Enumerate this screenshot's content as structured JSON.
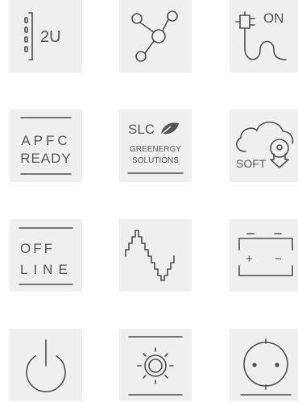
{
  "tiles": [
    {
      "id": "rack-2u",
      "text": "2U"
    },
    {
      "id": "network"
    },
    {
      "id": "plug-on",
      "text": "ON"
    },
    {
      "id": "apfc",
      "line1": "APFC",
      "line2": "READY"
    },
    {
      "id": "slc",
      "line1": "SLC",
      "line2": "GREENERGY",
      "line3": "SOLUTIONS"
    },
    {
      "id": "cloud-soft",
      "text": "SOFT"
    },
    {
      "id": "offline",
      "line1": "OFF",
      "line2": "LINE"
    },
    {
      "id": "sine-wave"
    },
    {
      "id": "battery",
      "plus": "+",
      "minus": "−"
    },
    {
      "id": "power"
    },
    {
      "id": "display-sun"
    },
    {
      "id": "socket"
    }
  ],
  "colors": {
    "tile_bg": "#efefef",
    "stroke": "#4d4d4d"
  }
}
